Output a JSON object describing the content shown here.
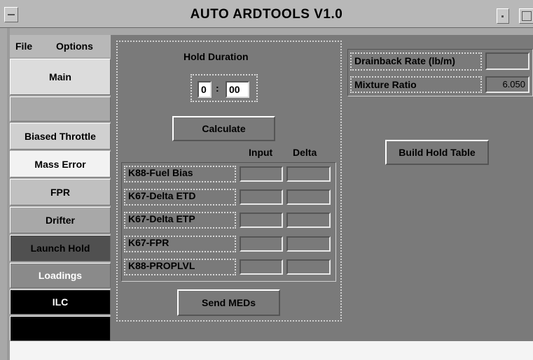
{
  "window": {
    "title": "AUTO ARDTOOLS V1.0",
    "menu_icon": "window-menu-icon",
    "minimize_icon": "minimize-icon",
    "maximize_icon": "maximize-icon"
  },
  "menubar": {
    "file": "File",
    "options": "Options"
  },
  "sidebar": {
    "items": [
      {
        "label": "Main",
        "bg": "#dcdcdc",
        "fg": "#000000"
      },
      {
        "label": "",
        "bg": "#a9a9a9",
        "fg": "#000000"
      },
      {
        "label": "Biased Throttle",
        "bg": "#d0d0d0",
        "fg": "#000000"
      },
      {
        "label": "Mass Error",
        "bg": "#f2f2f2",
        "fg": "#000000"
      },
      {
        "label": "FPR",
        "bg": "#c0c0c0",
        "fg": "#000000"
      },
      {
        "label": "Drifter",
        "bg": "#a8a8a8",
        "fg": "#000000"
      },
      {
        "label": "Launch Hold",
        "bg": "#505050",
        "fg": "#000000"
      },
      {
        "label": "Loadings",
        "bg": "#8a8a8a",
        "fg": "#ffffff"
      },
      {
        "label": "ILC",
        "bg": "#000000",
        "fg": "#ffffff"
      },
      {
        "label": "",
        "bg": "#000000",
        "fg": "#ffffff"
      }
    ]
  },
  "hold": {
    "title": "Hold Duration",
    "minutes": "0",
    "separator": ":",
    "seconds": "00",
    "calculate": "Calculate",
    "col_input": "Input",
    "col_delta": "Delta",
    "rows": [
      {
        "label": "K88-Fuel Bias",
        "input": "",
        "delta": ""
      },
      {
        "label": "K67-Delta ETD",
        "input": "",
        "delta": ""
      },
      {
        "label": "K67-Delta ETP",
        "input": "",
        "delta": ""
      },
      {
        "label": "K67-FPR",
        "input": "",
        "delta": ""
      },
      {
        "label": "K88-PROPLVL",
        "input": "",
        "delta": ""
      }
    ],
    "send": "Send MEDs"
  },
  "right": {
    "drainback_label": "Drainback Rate (lb/m)",
    "drainback_value": "",
    "mixture_label": "Mixture Ratio",
    "mixture_value": "6.050",
    "build_table": "Build Hold Table"
  }
}
